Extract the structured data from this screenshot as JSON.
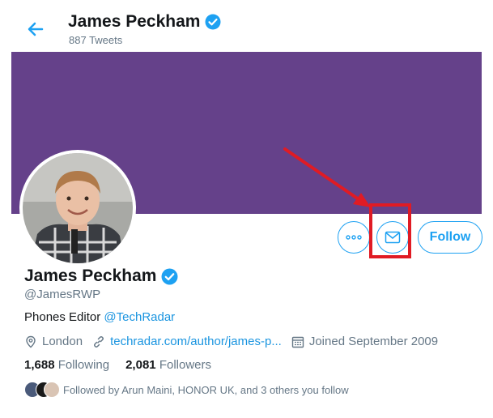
{
  "header": {
    "title": "James Peckham",
    "tweet_count": "887 Tweets"
  },
  "profile": {
    "name": "James Peckham",
    "handle": "@JamesRWP",
    "bio_text": "Phones Editor ",
    "bio_mention": "@TechRadar",
    "location": "London",
    "website": "techradar.com/author/james-p...",
    "joined": "Joined September 2009",
    "following_count": "1,688",
    "following_label": "Following",
    "followers_count": "2,081",
    "followers_label": "Followers",
    "followed_by": "Followed by Arun Maini, HONOR UK, and 3 others you follow"
  },
  "actions": {
    "follow_label": "Follow"
  },
  "colors": {
    "accent": "#1da1f2",
    "banner": "#65418a",
    "annotation": "#e01b24"
  },
  "icons": [
    "back-arrow-icon",
    "verified-badge-icon",
    "more-icon",
    "message-icon",
    "location-icon",
    "link-icon",
    "calendar-icon"
  ]
}
